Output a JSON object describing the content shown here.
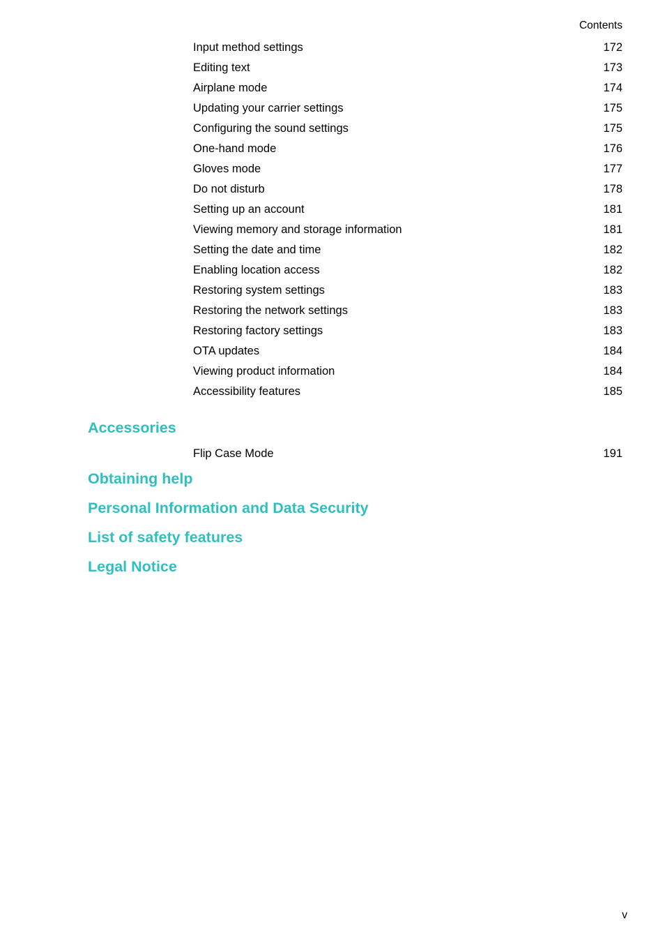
{
  "document": {
    "running_header": "Contents",
    "folio": "v"
  },
  "toc": {
    "leading_entries": [
      {
        "title": "Input method settings",
        "page": "172"
      },
      {
        "title": "Editing text",
        "page": "173"
      },
      {
        "title": "Airplane mode",
        "page": "174"
      },
      {
        "title": "Updating your carrier settings",
        "page": "175"
      },
      {
        "title": "Configuring the sound settings",
        "page": "175"
      },
      {
        "title": "One-hand mode",
        "page": "176"
      },
      {
        "title": "Gloves mode",
        "page": "177"
      },
      {
        "title": "Do not disturb",
        "page": "178"
      },
      {
        "title": "Setting up an account",
        "page": "181"
      },
      {
        "title": "Viewing memory and storage information",
        "page": "181"
      },
      {
        "title": "Setting the date and time",
        "page": "182"
      },
      {
        "title": "Enabling location access",
        "page": "182"
      },
      {
        "title": "Restoring system settings",
        "page": "183"
      },
      {
        "title": "Restoring the network settings",
        "page": "183"
      },
      {
        "title": "Restoring factory settings",
        "page": "183"
      },
      {
        "title": "OTA updates",
        "page": "184"
      },
      {
        "title": "Viewing product information",
        "page": "184"
      },
      {
        "title": "Accessibility features",
        "page": "185"
      }
    ],
    "parts": [
      {
        "heading": "Accessories",
        "entries": [
          {
            "title": "Flip Case Mode",
            "page": "191"
          }
        ]
      },
      {
        "heading": "Obtaining help",
        "entries": []
      },
      {
        "heading": "Personal Information and Data Security",
        "entries": []
      },
      {
        "heading": "List of safety features",
        "entries": []
      },
      {
        "heading": "Legal Notice",
        "entries": []
      }
    ]
  },
  "theme": {
    "heading_color": "#2fbfc0",
    "text_color": "#000000",
    "page_background": "#ffffff"
  }
}
